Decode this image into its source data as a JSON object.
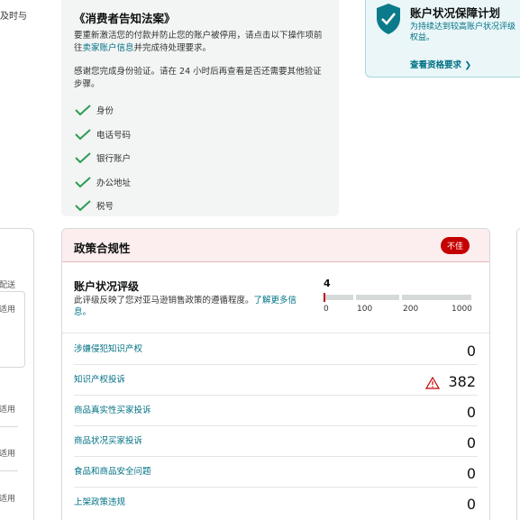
{
  "left": {
    "top_text": "及时与",
    "labels": [
      "配送",
      "适用",
      "适用",
      "适用",
      "适用"
    ]
  },
  "notice": {
    "title": "《消费者告知法案》",
    "paragraph1": "要重新激活您的付款并防止您的账户被停用，请点击以下操作项前往",
    "paragraph1_link": "卖家账户信息",
    "paragraph1_end": "并完成待处理要求。",
    "paragraph2": "感谢您完成身份验证。请在 24 小时后再查看是否还需要其他验证步骤。",
    "items": [
      "身份",
      "电话号码",
      "银行账户",
      "办公地址",
      "税号"
    ]
  },
  "guarantee": {
    "title": "账户状况保障计划",
    "description_line1": "为持续达到较高账户状况评级",
    "description_line2": "权益。",
    "link": "查看资格要求 ❯"
  },
  "policy": {
    "title": "政策合规性",
    "badge": "不佳",
    "rating_title": "账户状况评级",
    "rating_desc": "此评级反映了您对亚马逊销售政策的遵循程度。",
    "rating_link": "了解更多信息。",
    "score": "4",
    "ticks": [
      "0",
      "100",
      "200",
      "1000"
    ],
    "metrics": [
      {
        "name": "涉嫌侵犯知识产权",
        "value": "0",
        "warning": false
      },
      {
        "name": "知识产权投诉",
        "value": "382",
        "warning": true
      },
      {
        "name": "商品真实性买家投诉",
        "value": "0",
        "warning": false
      },
      {
        "name": "商品状况买家投诉",
        "value": "0",
        "warning": false
      },
      {
        "name": "食品和商品安全问题",
        "value": "0",
        "warning": false
      },
      {
        "name": "上架政策违规",
        "value": "0",
        "warning": false
      }
    ]
  },
  "colors": {
    "check": "#2e9c57",
    "shield": "#0b7a8a",
    "badge": "#c40000",
    "link": "#007185",
    "warning": "#c40000"
  }
}
